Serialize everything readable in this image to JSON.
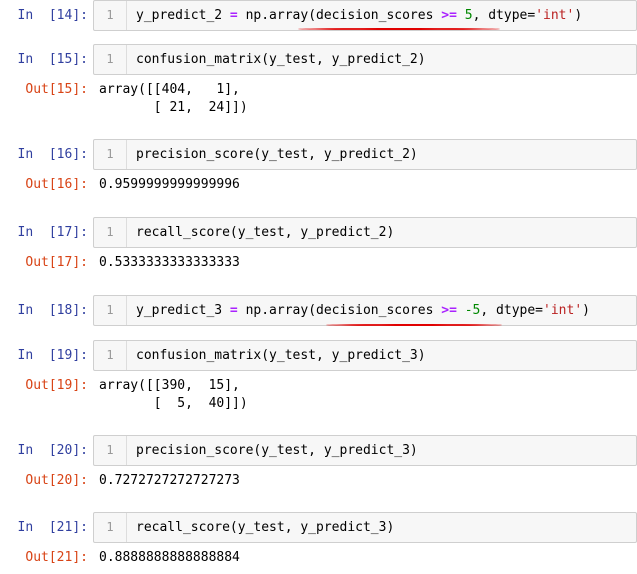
{
  "cells": [
    {
      "in_prompt": "In  [14]:",
      "code": {
        "pre": "y_predict_2 ",
        "op1": "=",
        "mid": " np.array(decision_scores ",
        "op2": ">=",
        "sp": " ",
        "num": "5",
        "after": ", dtype=",
        "str": "'int'",
        "end": ")"
      }
    },
    {
      "in_prompt": "In  [15]:",
      "code_text": "confusion_matrix(y_test, y_predict_2)",
      "out_prompt": "Out[15]:",
      "output": "array([[404,   1],\n       [ 21,  24]])"
    },
    {
      "in_prompt": "In  [16]:",
      "code_text": "precision_score(y_test, y_predict_2)",
      "out_prompt": "Out[16]:",
      "output": "0.9599999999999996"
    },
    {
      "in_prompt": "In  [17]:",
      "code_text": "recall_score(y_test, y_predict_2)",
      "out_prompt": "Out[17]:",
      "output": "0.5333333333333333"
    },
    {
      "in_prompt": "In  [18]:",
      "code": {
        "pre": "y_predict_3 ",
        "op1": "=",
        "mid": " np.array(decision_scores ",
        "op2": ">=",
        "sp": " ",
        "num": "-5",
        "after": ", dtype=",
        "str": "'int'",
        "end": ")"
      }
    },
    {
      "in_prompt": "In  [19]:",
      "code_text": "confusion_matrix(y_test, y_predict_3)",
      "out_prompt": "Out[19]:",
      "output": "array([[390,  15],\n       [  5,  40]])"
    },
    {
      "in_prompt": "In  [20]:",
      "code_text": "precision_score(y_test, y_predict_3)",
      "out_prompt": "Out[20]:",
      "output": "0.7272727272727273"
    },
    {
      "in_prompt": "In  [21]:",
      "code_text": "recall_score(y_test, y_predict_3)",
      "out_prompt": "Out[21]:",
      "output": "0.8888888888888884"
    }
  ],
  "line_number": "1",
  "annotation_color": "#e00000"
}
